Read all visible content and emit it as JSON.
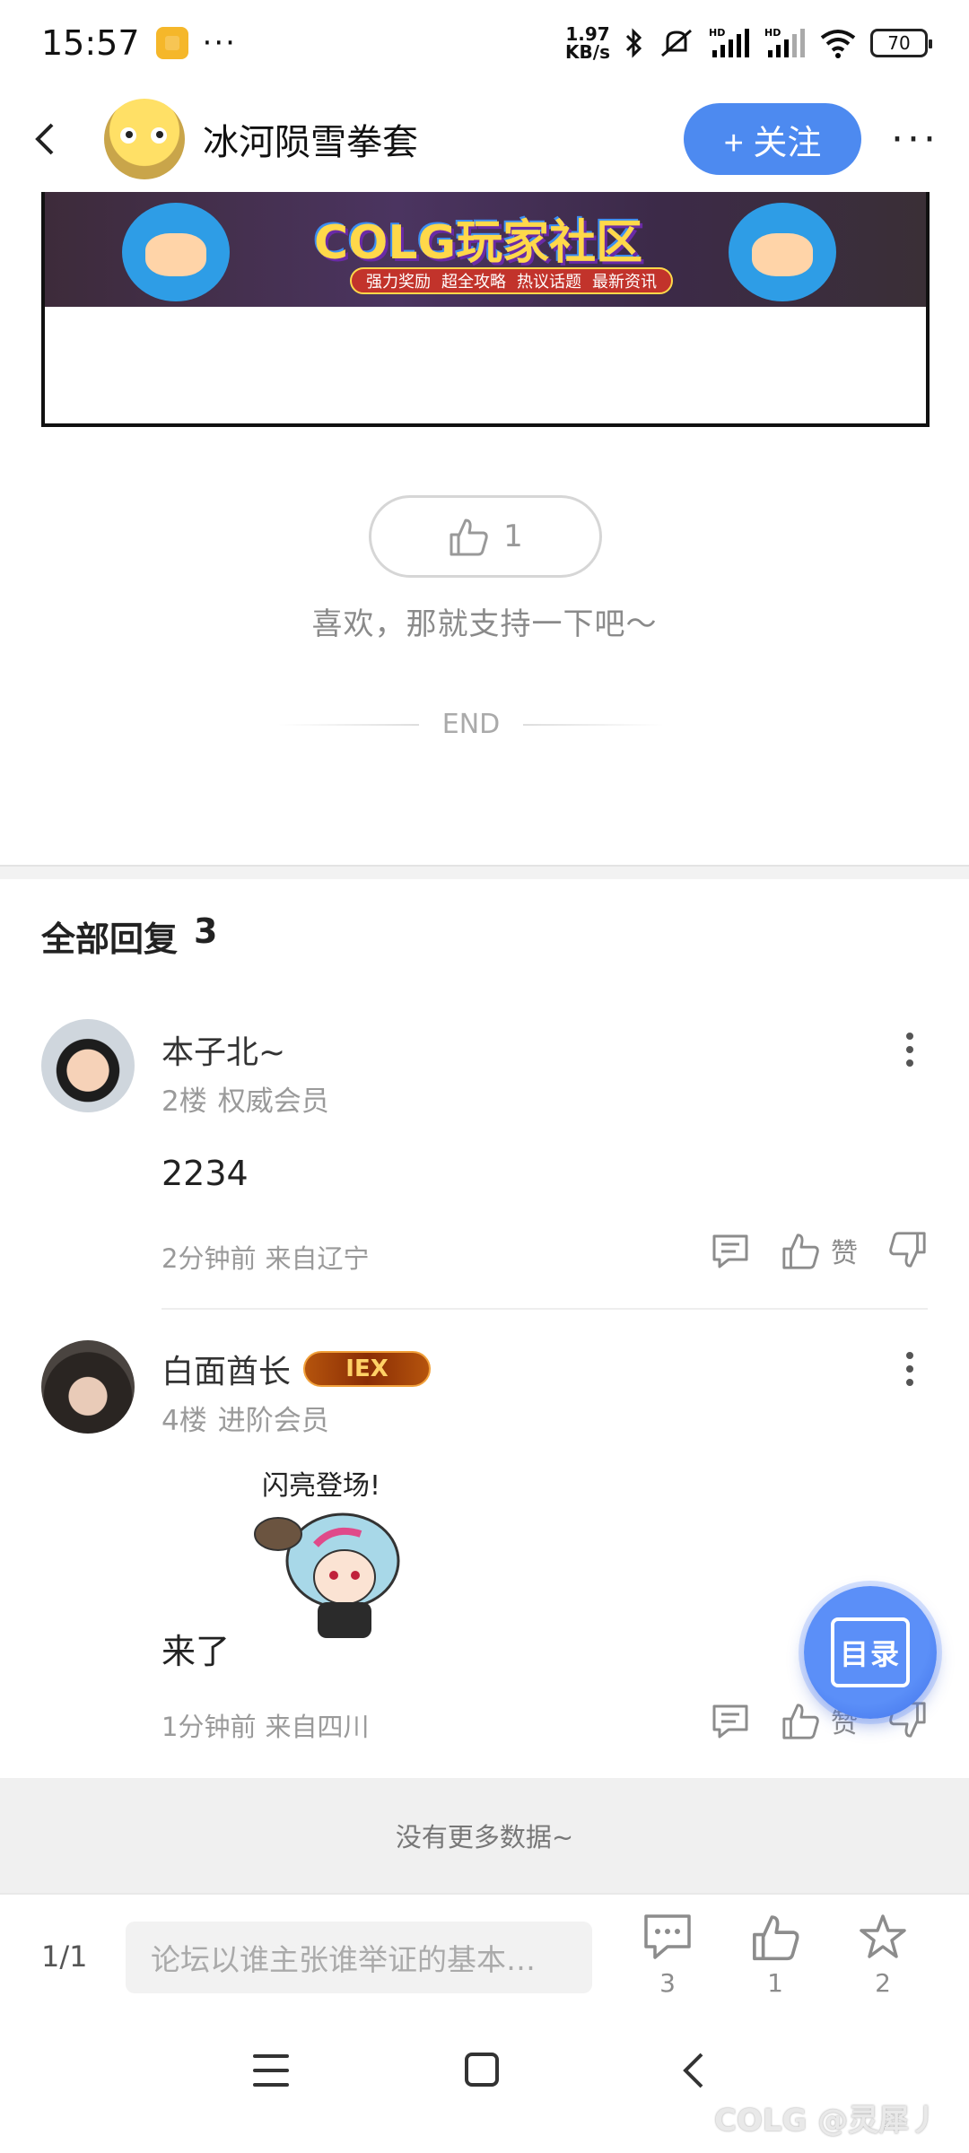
{
  "status_bar": {
    "time": "15:57",
    "more": "···",
    "speed_value": "1.97",
    "speed_unit": "KB/s",
    "battery": "70",
    "colors": {
      "notification": "#f5b72a"
    }
  },
  "header": {
    "title": "冰河陨雪拳套",
    "follow_label": "+ 关注",
    "accent": "#4d8af0"
  },
  "banner": {
    "logo_text": "COLG玩家社区",
    "tags": [
      "强力奖励",
      "超全攻略",
      "热议话题",
      "最新资讯"
    ]
  },
  "like": {
    "count": "1",
    "support_text": "喜欢，那就支持一下吧～",
    "end_label": "END"
  },
  "replies": {
    "title": "全部回复",
    "count": "3",
    "items": [
      {
        "name": "本子北~",
        "floor": "2楼",
        "rank": "权威会员",
        "content": "2234",
        "time": "2分钟前",
        "location": "来自辽宁",
        "like_label": "赞"
      },
      {
        "name": "白面酋长",
        "badge": "IEX",
        "floor": "4楼",
        "rank": "进阶会员",
        "sticker_text": "闪亮登场!",
        "content": "来了",
        "time": "1分钟前",
        "location": "来自四川",
        "like_label": "赞"
      }
    ]
  },
  "no_more": "没有更多数据~",
  "toc_label": "目录",
  "bottom_bar": {
    "page": "1/1",
    "input_placeholder": "论坛以谁主张谁举证的基本…",
    "comment_count": "3",
    "like_count": "1",
    "fav_count": "2"
  },
  "watermark": "COLG @灵犀丿"
}
